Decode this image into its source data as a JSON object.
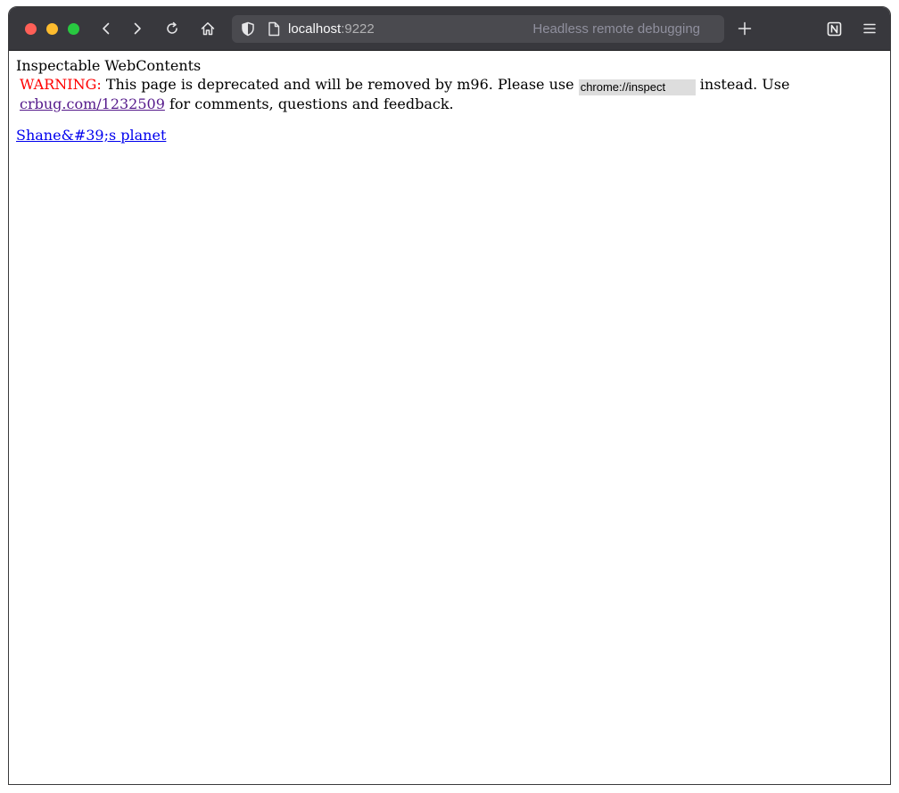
{
  "browser": {
    "url_host": "localhost",
    "url_port": ":9222",
    "url_hint": "Headless remote debugging",
    "icons": [
      "back-arrow-icon",
      "forward-arrow-icon",
      "reload-icon",
      "home-icon",
      "shield-icon",
      "page-icon",
      "plus-icon",
      "notion-icon",
      "hamburger-menu-icon"
    ],
    "colors": {
      "toolbar": "#38383d",
      "urlbar": "#4a4a4f",
      "close": "#ff5f57",
      "minimize": "#febc2e",
      "maximize": "#28c840"
    }
  },
  "page": {
    "title": "Inspectable WebContents",
    "warning_label": "WARNING:",
    "warning_text_1": "This page is deprecated and will be removed by m96. Please use",
    "inspect_value": "chrome://inspect",
    "warning_text_2": "instead. Use",
    "bug_link": "crbug.com/1232509",
    "warning_text_3": "for comments, questions and feedback.",
    "targets": [
      {
        "label": "Shane&#39;s planet"
      }
    ],
    "colors": {
      "warning": "#ff0000",
      "link": "#0000ee",
      "visited_link": "#551a8b",
      "code_bg": "#dddddd"
    }
  }
}
